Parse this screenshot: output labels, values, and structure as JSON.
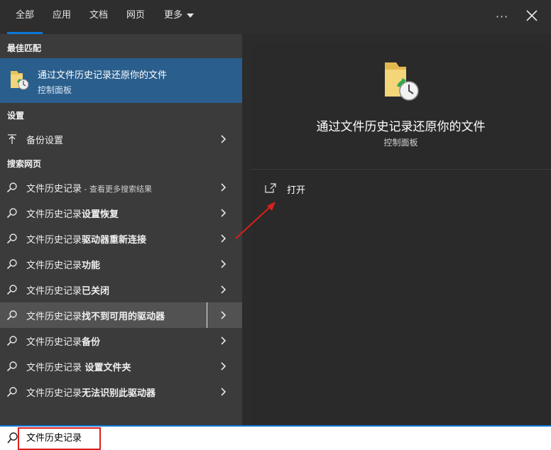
{
  "tabs": [
    {
      "label": "全部",
      "active": true
    },
    {
      "label": "应用"
    },
    {
      "label": "文档"
    },
    {
      "label": "网页"
    },
    {
      "label": "更多"
    }
  ],
  "sections": {
    "best_match": "最佳匹配",
    "settings": "设置",
    "web": "搜索网页"
  },
  "best_match": {
    "title": "通过文件历史记录还原你的文件",
    "subtitle": "控制面板",
    "icon": "folder-history-icon"
  },
  "settings_item": {
    "label": "备份设置",
    "icon": "upload-arrow-icon"
  },
  "web_results": [
    {
      "base": "文件历史记录",
      "bold": "",
      "small": " - 查看更多搜索结果"
    },
    {
      "base": "文件历史记录",
      "bold": "设置恢复",
      "small": ""
    },
    {
      "base": "文件历史记录",
      "bold": "驱动器重新连接",
      "small": ""
    },
    {
      "base": "文件历史记录",
      "bold": "功能",
      "small": ""
    },
    {
      "base": "文件历史记录",
      "bold": "已关闭",
      "small": ""
    },
    {
      "base": "文件历史记录",
      "bold": "找不到可用的驱动器",
      "small": "",
      "hover": true
    },
    {
      "base": "文件历史记录",
      "bold": "备份",
      "small": ""
    },
    {
      "base": "文件历史记录",
      "bold": " 设置文件夹",
      "small": ""
    },
    {
      "base": "文件历史记录",
      "bold": "无法识别此驱动器",
      "small": ""
    }
  ],
  "preview": {
    "title": "通过文件历史记录还原你的文件",
    "subtitle": "控制面板",
    "open_label": "打开"
  },
  "search": {
    "value": "文件历史记录"
  },
  "colors": {
    "accent": "#0a78d7",
    "highlight": "#2a5f8d",
    "annotation": "#d9201c"
  }
}
